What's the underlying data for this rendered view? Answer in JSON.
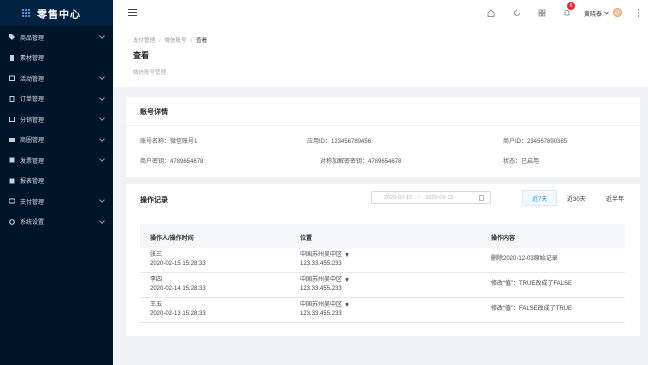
{
  "app": {
    "title": "零售中心"
  },
  "sidebar": {
    "items": [
      {
        "label": "商品管理",
        "icon": "tag-icon"
      },
      {
        "label": "素材管理",
        "icon": "file-icon"
      },
      {
        "label": "活动管理",
        "icon": "calendar-icon"
      },
      {
        "label": "订单管理",
        "icon": "receipt-icon"
      },
      {
        "label": "分销管理",
        "icon": "share-icon"
      },
      {
        "label": "商圈管理",
        "icon": "store-icon"
      },
      {
        "label": "发票管理",
        "icon": "invoice-icon"
      },
      {
        "label": "报表管理",
        "icon": "report-icon"
      },
      {
        "label": "支付管理",
        "icon": "card-icon"
      },
      {
        "label": "系统设置",
        "icon": "gear-icon"
      }
    ]
  },
  "topbar": {
    "notification_count": "6",
    "user_name": "黄晓泰",
    "accent": "#1890ff"
  },
  "breadcrumb": {
    "items": [
      "支付管理",
      "微信账号",
      "查看"
    ]
  },
  "page": {
    "title": "查看",
    "subtitle": "微信账号管理"
  },
  "account": {
    "title": "账号详情",
    "fields": {
      "name": "账号名称：微信账号1",
      "app_id": "应用ID：123456789456",
      "merchant_id": "商户ID：234567890365",
      "merchant_key": "商户密钥：4789654678",
      "sym_key": "对称加解密密钥：4789654678",
      "status_label": "状态：",
      "status_value": "已启用"
    }
  },
  "oplog": {
    "title": "操作记录",
    "date_start": "2020-02-15",
    "date_sep": "~",
    "date_end": "2020-02-15",
    "ranges": [
      "近7天",
      "近30天",
      "近半年"
    ],
    "active_range": 0,
    "columns": [
      "操作人/操作时间",
      "位置",
      "操作内容"
    ],
    "rows": [
      {
        "user": "张三",
        "time": "2020-02-15 15:28:33",
        "place": "中国苏州吴中区",
        "ip": "123.33.455.233",
        "action": "删除2020-12-03原始记录"
      },
      {
        "user": "李四",
        "time": "2020-02-14 15:28:33",
        "place": "中国苏州吴中区",
        "ip": "123.33.455.233",
        "action": "修改“值”：TRUE改成了FALSE"
      },
      {
        "user": "王五",
        "time": "2020-02-13 15:28:33",
        "place": "中国苏州吴中区",
        "ip": "123.33.455.233",
        "action": "修改“值”：FALSE改成了TRUE"
      }
    ]
  }
}
